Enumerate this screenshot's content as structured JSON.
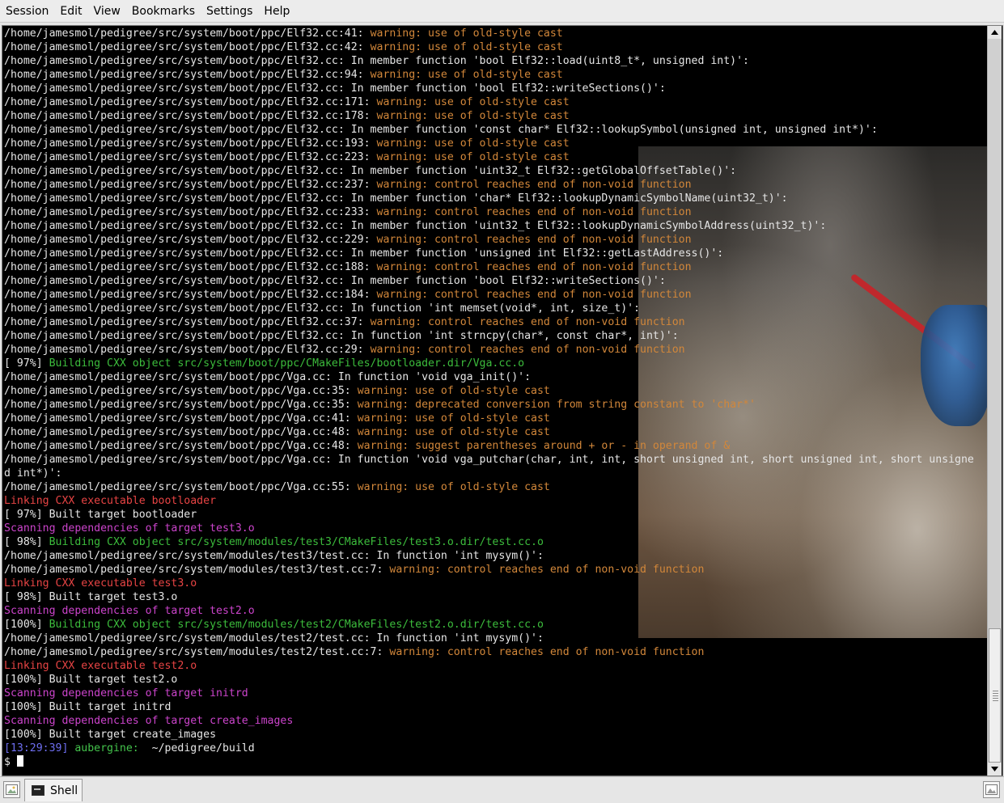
{
  "menubar": {
    "items": [
      {
        "label": "Session"
      },
      {
        "label": "Edit"
      },
      {
        "label": "View"
      },
      {
        "label": "Bookmarks"
      },
      {
        "label": "Settings"
      },
      {
        "label": "Help"
      }
    ]
  },
  "colors": {
    "plain": "#e6e6e6",
    "warning": "#d2873a",
    "building": "#3cbc3c",
    "linking": "#e84444",
    "scanning": "#cc44cc",
    "timestamp": "#6e6ef0",
    "hostname": "#44c44c"
  },
  "terminal": {
    "lines": [
      {
        "segments": [
          {
            "text": "/home/jamesmol/pedigree/src/system/boot/ppc/Elf32.cc:41: ",
            "style": "p"
          },
          {
            "text": "warning: use of old-style cast",
            "style": "warn"
          }
        ]
      },
      {
        "segments": [
          {
            "text": "/home/jamesmol/pedigree/src/system/boot/ppc/Elf32.cc:42: ",
            "style": "p"
          },
          {
            "text": "warning: use of old-style cast",
            "style": "warn"
          }
        ]
      },
      {
        "segments": [
          {
            "text": "/home/jamesmol/pedigree/src/system/boot/ppc/Elf32.cc: In member function 'bool Elf32::load(uint8_t*, unsigned int)':",
            "style": "p"
          }
        ]
      },
      {
        "segments": [
          {
            "text": "/home/jamesmol/pedigree/src/system/boot/ppc/Elf32.cc:94: ",
            "style": "p"
          },
          {
            "text": "warning: use of old-style cast",
            "style": "warn"
          }
        ]
      },
      {
        "segments": [
          {
            "text": "/home/jamesmol/pedigree/src/system/boot/ppc/Elf32.cc: In member function 'bool Elf32::writeSections()':",
            "style": "p"
          }
        ]
      },
      {
        "segments": [
          {
            "text": "/home/jamesmol/pedigree/src/system/boot/ppc/Elf32.cc:171: ",
            "style": "p"
          },
          {
            "text": "warning: use of old-style cast",
            "style": "warn"
          }
        ]
      },
      {
        "segments": [
          {
            "text": "/home/jamesmol/pedigree/src/system/boot/ppc/Elf32.cc:178: ",
            "style": "p"
          },
          {
            "text": "warning: use of old-style cast",
            "style": "warn"
          }
        ]
      },
      {
        "segments": [
          {
            "text": "/home/jamesmol/pedigree/src/system/boot/ppc/Elf32.cc: In member function 'const char* Elf32::lookupSymbol(unsigned int, unsigned int*)':",
            "style": "p"
          }
        ]
      },
      {
        "segments": [
          {
            "text": "/home/jamesmol/pedigree/src/system/boot/ppc/Elf32.cc:193: ",
            "style": "p"
          },
          {
            "text": "warning: use of old-style cast",
            "style": "warn"
          }
        ]
      },
      {
        "segments": [
          {
            "text": "/home/jamesmol/pedigree/src/system/boot/ppc/Elf32.cc:223: ",
            "style": "p"
          },
          {
            "text": "warning: use of old-style cast",
            "style": "warn"
          }
        ]
      },
      {
        "segments": [
          {
            "text": "/home/jamesmol/pedigree/src/system/boot/ppc/Elf32.cc: In member function 'uint32_t Elf32::getGlobalOffsetTable()':",
            "style": "p"
          }
        ]
      },
      {
        "segments": [
          {
            "text": "/home/jamesmol/pedigree/src/system/boot/ppc/Elf32.cc:237: ",
            "style": "p"
          },
          {
            "text": "warning: control reaches end of non-void function",
            "style": "warn"
          }
        ]
      },
      {
        "segments": [
          {
            "text": "/home/jamesmol/pedigree/src/system/boot/ppc/Elf32.cc: In member function 'char* Elf32::lookupDynamicSymbolName(uint32_t)':",
            "style": "p"
          }
        ]
      },
      {
        "segments": [
          {
            "text": "/home/jamesmol/pedigree/src/system/boot/ppc/Elf32.cc:233: ",
            "style": "p"
          },
          {
            "text": "warning: control reaches end of non-void function",
            "style": "warn"
          }
        ]
      },
      {
        "segments": [
          {
            "text": "/home/jamesmol/pedigree/src/system/boot/ppc/Elf32.cc: In member function 'uint32_t Elf32::lookupDynamicSymbolAddress(uint32_t)':",
            "style": "p"
          }
        ]
      },
      {
        "segments": [
          {
            "text": "/home/jamesmol/pedigree/src/system/boot/ppc/Elf32.cc:229: ",
            "style": "p"
          },
          {
            "text": "warning: control reaches end of non-void function",
            "style": "warn"
          }
        ]
      },
      {
        "segments": [
          {
            "text": "/home/jamesmol/pedigree/src/system/boot/ppc/Elf32.cc: In member function 'unsigned int Elf32::getLastAddress()':",
            "style": "p"
          }
        ]
      },
      {
        "segments": [
          {
            "text": "/home/jamesmol/pedigree/src/system/boot/ppc/Elf32.cc:188: ",
            "style": "p"
          },
          {
            "text": "warning: control reaches end of non-void function",
            "style": "warn"
          }
        ]
      },
      {
        "segments": [
          {
            "text": "/home/jamesmol/pedigree/src/system/boot/ppc/Elf32.cc: In member function 'bool Elf32::writeSections()':",
            "style": "p"
          }
        ]
      },
      {
        "segments": [
          {
            "text": "/home/jamesmol/pedigree/src/system/boot/ppc/Elf32.cc:184: ",
            "style": "p"
          },
          {
            "text": "warning: control reaches end of non-void function",
            "style": "warn"
          }
        ]
      },
      {
        "segments": [
          {
            "text": "/home/jamesmol/pedigree/src/system/boot/ppc/Elf32.cc: In function 'int memset(void*, int, size_t)':",
            "style": "p"
          }
        ]
      },
      {
        "segments": [
          {
            "text": "/home/jamesmol/pedigree/src/system/boot/ppc/Elf32.cc:37: ",
            "style": "p"
          },
          {
            "text": "warning: control reaches end of non-void function",
            "style": "warn"
          }
        ]
      },
      {
        "segments": [
          {
            "text": "/home/jamesmol/pedigree/src/system/boot/ppc/Elf32.cc: In function 'int strncpy(char*, const char*, int)':",
            "style": "p"
          }
        ]
      },
      {
        "segments": [
          {
            "text": "/home/jamesmol/pedigree/src/system/boot/ppc/Elf32.cc:29: ",
            "style": "p"
          },
          {
            "text": "warning: control reaches end of non-void function",
            "style": "warn"
          }
        ]
      },
      {
        "segments": [
          {
            "text": "[ 97%] ",
            "style": "p"
          },
          {
            "text": "Building CXX object src/system/boot/ppc/CMakeFiles/bootloader.dir/Vga.cc.o",
            "style": "build"
          }
        ]
      },
      {
        "segments": [
          {
            "text": "/home/jamesmol/pedigree/src/system/boot/ppc/Vga.cc: In function 'void vga_init()':",
            "style": "p"
          }
        ]
      },
      {
        "segments": [
          {
            "text": "/home/jamesmol/pedigree/src/system/boot/ppc/Vga.cc:35: ",
            "style": "p"
          },
          {
            "text": "warning: use of old-style cast",
            "style": "warn"
          }
        ]
      },
      {
        "segments": [
          {
            "text": "/home/jamesmol/pedigree/src/system/boot/ppc/Vga.cc:35: ",
            "style": "p"
          },
          {
            "text": "warning: deprecated conversion from string constant to 'char*'",
            "style": "warn"
          }
        ]
      },
      {
        "segments": [
          {
            "text": "/home/jamesmol/pedigree/src/system/boot/ppc/Vga.cc:41: ",
            "style": "p"
          },
          {
            "text": "warning: use of old-style cast",
            "style": "warn"
          }
        ]
      },
      {
        "segments": [
          {
            "text": "/home/jamesmol/pedigree/src/system/boot/ppc/Vga.cc:48: ",
            "style": "p"
          },
          {
            "text": "warning: use of old-style cast",
            "style": "warn"
          }
        ]
      },
      {
        "segments": [
          {
            "text": "/home/jamesmol/pedigree/src/system/boot/ppc/Vga.cc:48: ",
            "style": "p"
          },
          {
            "text": "warning: suggest parentheses around + or - in operand of &",
            "style": "warn"
          }
        ]
      },
      {
        "segments": [
          {
            "text": "/home/jamesmol/pedigree/src/system/boot/ppc/Vga.cc: In function 'void vga_putchar(char, int, int, short unsigned int, short unsigned int, short unsigne",
            "style": "p"
          }
        ]
      },
      {
        "segments": [
          {
            "text": "d int*)':",
            "style": "p"
          }
        ]
      },
      {
        "segments": [
          {
            "text": "/home/jamesmol/pedigree/src/system/boot/ppc/Vga.cc:55: ",
            "style": "p"
          },
          {
            "text": "warning: use of old-style cast",
            "style": "warn"
          }
        ]
      },
      {
        "segments": [
          {
            "text": "Linking CXX executable bootloader",
            "style": "link"
          }
        ]
      },
      {
        "segments": [
          {
            "text": "[ 97%] Built target bootloader",
            "style": "p"
          }
        ]
      },
      {
        "segments": [
          {
            "text": "Scanning dependencies of target test3.o",
            "style": "scan"
          }
        ]
      },
      {
        "segments": [
          {
            "text": "[ 98%] ",
            "style": "p"
          },
          {
            "text": "Building CXX object src/system/modules/test3/CMakeFiles/test3.o.dir/test.cc.o",
            "style": "build"
          }
        ]
      },
      {
        "segments": [
          {
            "text": "/home/jamesmol/pedigree/src/system/modules/test3/test.cc: In function 'int mysym()':",
            "style": "p"
          }
        ]
      },
      {
        "segments": [
          {
            "text": "/home/jamesmol/pedigree/src/system/modules/test3/test.cc:7: ",
            "style": "p"
          },
          {
            "text": "warning: control reaches end of non-void function",
            "style": "warn"
          }
        ]
      },
      {
        "segments": [
          {
            "text": "Linking CXX executable test3.o",
            "style": "link"
          }
        ]
      },
      {
        "segments": [
          {
            "text": "[ 98%] Built target test3.o",
            "style": "p"
          }
        ]
      },
      {
        "segments": [
          {
            "text": "Scanning dependencies of target test2.o",
            "style": "scan"
          }
        ]
      },
      {
        "segments": [
          {
            "text": "[100%] ",
            "style": "p"
          },
          {
            "text": "Building CXX object src/system/modules/test2/CMakeFiles/test2.o.dir/test.cc.o",
            "style": "build"
          }
        ]
      },
      {
        "segments": [
          {
            "text": "/home/jamesmol/pedigree/src/system/modules/test2/test.cc: In function 'int mysym()':",
            "style": "p"
          }
        ]
      },
      {
        "segments": [
          {
            "text": "/home/jamesmol/pedigree/src/system/modules/test2/test.cc:7: ",
            "style": "p"
          },
          {
            "text": "warning: control reaches end of non-void function",
            "style": "warn"
          }
        ]
      },
      {
        "segments": [
          {
            "text": "Linking CXX executable test2.o",
            "style": "link"
          }
        ]
      },
      {
        "segments": [
          {
            "text": "[100%] Built target test2.o",
            "style": "p"
          }
        ]
      },
      {
        "segments": [
          {
            "text": "Scanning dependencies of target initrd",
            "style": "scan"
          }
        ]
      },
      {
        "segments": [
          {
            "text": "[100%] Built target initrd",
            "style": "p"
          }
        ]
      },
      {
        "segments": [
          {
            "text": "Scanning dependencies of target create_images",
            "style": "scan"
          }
        ]
      },
      {
        "segments": [
          {
            "text": "[100%] Built target create_images",
            "style": "p"
          }
        ]
      },
      {
        "segments": [
          {
            "text": "[13:29:39] ",
            "style": "time"
          },
          {
            "text": "aubergine:",
            "style": "host"
          },
          {
            "text": "  ~/pedigree/build",
            "style": "p"
          }
        ]
      }
    ],
    "prompt": {
      "text": "$ "
    }
  },
  "scrollbar": {
    "up_icon": "triangle-up",
    "down_icon": "triangle-down",
    "position": 1.0
  },
  "taskbar": {
    "left_icon": "desktop-icon",
    "tabs": [
      {
        "label": "Shell",
        "icon": "terminal-icon"
      }
    ],
    "right_icon": "pager-icon"
  }
}
